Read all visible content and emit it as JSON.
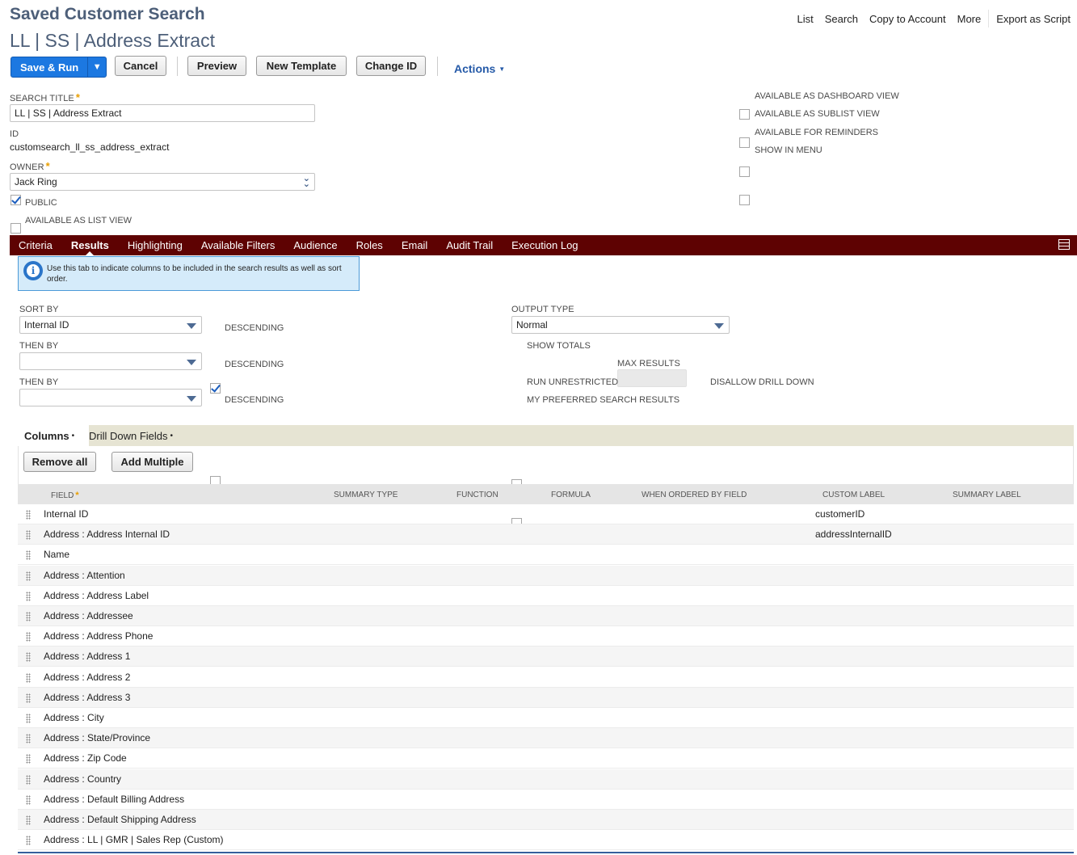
{
  "header": {
    "page_title": "Saved Customer Search",
    "record_title": "LL | SS | Address Extract",
    "top_links": [
      "List",
      "Search",
      "Copy to Account",
      "More"
    ],
    "export_link": "Export as Script"
  },
  "toolbar": {
    "save_run_label": "Save & Run",
    "cancel_label": "Cancel",
    "preview_label": "Preview",
    "new_template_label": "New Template",
    "change_id_label": "Change ID",
    "actions_label": "Actions"
  },
  "form": {
    "search_title_label": "SEARCH TITLE",
    "search_title_value": "LL | SS | Address Extract",
    "id_label": "ID",
    "id_value": "customsearch_ll_ss_address_extract",
    "owner_label": "OWNER",
    "owner_value": "Jack Ring",
    "public_label": "PUBLIC",
    "public_checked": true,
    "list_view_label": "AVAILABLE AS LIST VIEW",
    "list_view_checked": false,
    "right_options": [
      {
        "label": "AVAILABLE AS DASHBOARD VIEW",
        "checked": false
      },
      {
        "label": "AVAILABLE AS SUBLIST VIEW",
        "checked": false
      },
      {
        "label": "AVAILABLE FOR REMINDERS",
        "checked": false
      },
      {
        "label": "SHOW IN MENU",
        "checked": false
      }
    ]
  },
  "tabs": {
    "items": [
      {
        "label": "Criteria",
        "active": false
      },
      {
        "label": "Results",
        "active": true
      },
      {
        "label": "Highlighting",
        "active": false
      },
      {
        "label": "Available Filters",
        "active": false
      },
      {
        "label": "Audience",
        "active": false
      },
      {
        "label": "Roles",
        "active": false
      },
      {
        "label": "Email",
        "active": false
      },
      {
        "label": "Audit Trail",
        "active": false
      },
      {
        "label": "Execution Log",
        "active": false
      }
    ]
  },
  "results": {
    "info_text": "Use this tab to indicate columns to be included in the search results as well as sort order.",
    "sort_by_label": "SORT BY",
    "sort_by_value": "Internal ID",
    "sort_by_descending": true,
    "then_by_label": "THEN BY",
    "then_by_1_value": "",
    "then_by_1_descending": false,
    "then_by_2_value": "",
    "then_by_2_descending": false,
    "descending_label": "DESCENDING",
    "output_type_label": "OUTPUT TYPE",
    "output_type_value": "Normal",
    "show_totals_label": "SHOW TOTALS",
    "max_results_label": "MAX RESULTS",
    "max_results_value": "",
    "run_unrestricted_label": "RUN UNRESTRICTED",
    "disallow_drill_down_label": "DISALLOW DRILL DOWN",
    "preferred_results_label": "MY PREFERRED SEARCH RESULTS"
  },
  "subtabs": {
    "columns_label": "Columns",
    "drill_down_label": "Drill Down Fields",
    "dot": "•"
  },
  "grid": {
    "remove_all_label": "Remove all",
    "add_multiple_label": "Add Multiple",
    "headers": {
      "field": "FIELD",
      "summary_type": "SUMMARY TYPE",
      "function": "FUNCTION",
      "formula": "FORMULA",
      "when_ordered": "WHEN ORDERED BY FIELD",
      "custom_label": "CUSTOM LABEL",
      "summary_label": "SUMMARY LABEL"
    },
    "rows": [
      {
        "field": "Internal ID",
        "custom_label": "customerID"
      },
      {
        "field": "Address : Address Internal ID",
        "custom_label": "addressInternalID"
      },
      {
        "field": "Name",
        "custom_label": ""
      },
      {
        "field": "Address : Attention",
        "custom_label": ""
      },
      {
        "field": "Address : Address Label",
        "custom_label": ""
      },
      {
        "field": "Address : Addressee",
        "custom_label": ""
      },
      {
        "field": "Address : Address Phone",
        "custom_label": ""
      },
      {
        "field": "Address : Address 1",
        "custom_label": ""
      },
      {
        "field": "Address : Address 2",
        "custom_label": ""
      },
      {
        "field": "Address : Address 3",
        "custom_label": ""
      },
      {
        "field": "Address : City",
        "custom_label": ""
      },
      {
        "field": "Address : State/Province",
        "custom_label": ""
      },
      {
        "field": "Address : Zip Code",
        "custom_label": ""
      },
      {
        "field": "Address : Country",
        "custom_label": ""
      },
      {
        "field": "Address : Default Billing Address",
        "custom_label": ""
      },
      {
        "field": "Address : Default Shipping Address",
        "custom_label": ""
      },
      {
        "field": "Address : LL | GMR | Sales Rep (Custom)",
        "custom_label": ""
      }
    ]
  },
  "colors": {
    "title": "#4d5f79",
    "tabbar": "#5e0202",
    "primary_button": "#1c78e1",
    "info_bg": "#d5ebfa",
    "subtab_bg": "#e6e4d3"
  }
}
